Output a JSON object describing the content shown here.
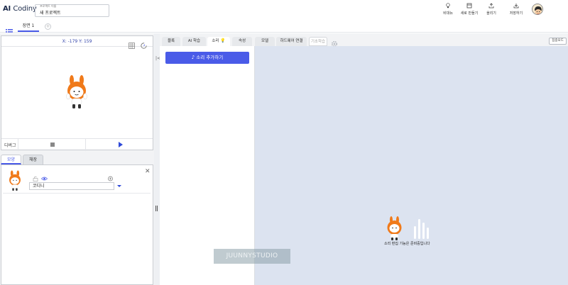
{
  "header": {
    "logo_bold": "AI",
    "logo_thin": "Codiny",
    "project_caption": "프로젝트 이름",
    "project_name": "새 프로젝트",
    "actions": [
      {
        "label": "비대뉴",
        "icon": "lightbulb-icon"
      },
      {
        "label": "새로 만들기",
        "icon": "new-file-icon"
      },
      {
        "label": "올리기",
        "icon": "upload-icon"
      },
      {
        "label": "저장하기",
        "icon": "download-icon"
      }
    ]
  },
  "scenes": {
    "tabs": [
      {
        "label": "장면 1"
      }
    ],
    "add_symbol": "+"
  },
  "stage": {
    "coords": "X: -179 Y: 159",
    "debug_label": "디버그"
  },
  "object_panel": {
    "tabs": [
      {
        "label": "모양"
      },
      {
        "label": "채장"
      }
    ],
    "object_name": "코디니"
  },
  "main_tabs": [
    {
      "label": "블록"
    },
    {
      "label": "AI 학습"
    },
    {
      "label": "소리"
    },
    {
      "label": "속성"
    },
    {
      "label": "모델"
    },
    {
      "label": "하드웨어 연결"
    },
    {
      "label": "기초학습"
    }
  ],
  "main_tab_active": "소리",
  "fullscreen_label": "집중모드",
  "sound": {
    "add_button": "소리 추가하기",
    "editor_message": "소리 편집 기능은 준비중입니다"
  },
  "watermark": "JUUNNYSTUDIO",
  "colors": {
    "accent": "#4a5be8",
    "editor_bg": "#dce3f0",
    "mascot_orange": "#f07a1a"
  }
}
